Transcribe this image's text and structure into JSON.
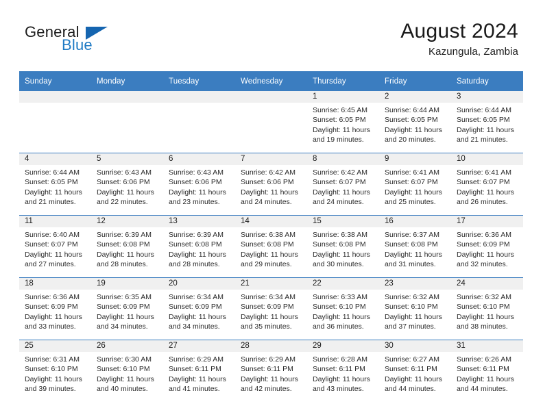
{
  "brand": {
    "word_one": "General",
    "word_two": "Blue",
    "triangle_icon": "triangle-icon",
    "accent_color": "#1f7ac4",
    "triangle_color": "#1565b0"
  },
  "header": {
    "title": "August 2024",
    "subtitle": "Kazungula, Zambia"
  },
  "theme": {
    "header_bg": "#3b7dc0",
    "header_text": "#ffffff",
    "daynum_bg": "#f0f0f0",
    "cell_bg": "#ffffff",
    "row_divider": "#3b7dc0"
  },
  "weekdays": [
    "Sunday",
    "Monday",
    "Tuesday",
    "Wednesday",
    "Thursday",
    "Friday",
    "Saturday"
  ],
  "labels": {
    "sunrise_prefix": "Sunrise:",
    "sunset_prefix": "Sunset:",
    "daylight_prefix": "Daylight:"
  },
  "weeks": [
    [
      {
        "day": "",
        "empty": true
      },
      {
        "day": "",
        "empty": true
      },
      {
        "day": "",
        "empty": true
      },
      {
        "day": "",
        "empty": true
      },
      {
        "day": "1",
        "sunrise": "Sunrise: 6:45 AM",
        "sunset": "Sunset: 6:05 PM",
        "daylight_line1": "Daylight: 11 hours",
        "daylight_line2": "and 19 minutes."
      },
      {
        "day": "2",
        "sunrise": "Sunrise: 6:44 AM",
        "sunset": "Sunset: 6:05 PM",
        "daylight_line1": "Daylight: 11 hours",
        "daylight_line2": "and 20 minutes."
      },
      {
        "day": "3",
        "sunrise": "Sunrise: 6:44 AM",
        "sunset": "Sunset: 6:05 PM",
        "daylight_line1": "Daylight: 11 hours",
        "daylight_line2": "and 21 minutes."
      }
    ],
    [
      {
        "day": "4",
        "sunrise": "Sunrise: 6:44 AM",
        "sunset": "Sunset: 6:05 PM",
        "daylight_line1": "Daylight: 11 hours",
        "daylight_line2": "and 21 minutes."
      },
      {
        "day": "5",
        "sunrise": "Sunrise: 6:43 AM",
        "sunset": "Sunset: 6:06 PM",
        "daylight_line1": "Daylight: 11 hours",
        "daylight_line2": "and 22 minutes."
      },
      {
        "day": "6",
        "sunrise": "Sunrise: 6:43 AM",
        "sunset": "Sunset: 6:06 PM",
        "daylight_line1": "Daylight: 11 hours",
        "daylight_line2": "and 23 minutes."
      },
      {
        "day": "7",
        "sunrise": "Sunrise: 6:42 AM",
        "sunset": "Sunset: 6:06 PM",
        "daylight_line1": "Daylight: 11 hours",
        "daylight_line2": "and 24 minutes."
      },
      {
        "day": "8",
        "sunrise": "Sunrise: 6:42 AM",
        "sunset": "Sunset: 6:07 PM",
        "daylight_line1": "Daylight: 11 hours",
        "daylight_line2": "and 24 minutes."
      },
      {
        "day": "9",
        "sunrise": "Sunrise: 6:41 AM",
        "sunset": "Sunset: 6:07 PM",
        "daylight_line1": "Daylight: 11 hours",
        "daylight_line2": "and 25 minutes."
      },
      {
        "day": "10",
        "sunrise": "Sunrise: 6:41 AM",
        "sunset": "Sunset: 6:07 PM",
        "daylight_line1": "Daylight: 11 hours",
        "daylight_line2": "and 26 minutes."
      }
    ],
    [
      {
        "day": "11",
        "sunrise": "Sunrise: 6:40 AM",
        "sunset": "Sunset: 6:07 PM",
        "daylight_line1": "Daylight: 11 hours",
        "daylight_line2": "and 27 minutes."
      },
      {
        "day": "12",
        "sunrise": "Sunrise: 6:39 AM",
        "sunset": "Sunset: 6:08 PM",
        "daylight_line1": "Daylight: 11 hours",
        "daylight_line2": "and 28 minutes."
      },
      {
        "day": "13",
        "sunrise": "Sunrise: 6:39 AM",
        "sunset": "Sunset: 6:08 PM",
        "daylight_line1": "Daylight: 11 hours",
        "daylight_line2": "and 28 minutes."
      },
      {
        "day": "14",
        "sunrise": "Sunrise: 6:38 AM",
        "sunset": "Sunset: 6:08 PM",
        "daylight_line1": "Daylight: 11 hours",
        "daylight_line2": "and 29 minutes."
      },
      {
        "day": "15",
        "sunrise": "Sunrise: 6:38 AM",
        "sunset": "Sunset: 6:08 PM",
        "daylight_line1": "Daylight: 11 hours",
        "daylight_line2": "and 30 minutes."
      },
      {
        "day": "16",
        "sunrise": "Sunrise: 6:37 AM",
        "sunset": "Sunset: 6:08 PM",
        "daylight_line1": "Daylight: 11 hours",
        "daylight_line2": "and 31 minutes."
      },
      {
        "day": "17",
        "sunrise": "Sunrise: 6:36 AM",
        "sunset": "Sunset: 6:09 PM",
        "daylight_line1": "Daylight: 11 hours",
        "daylight_line2": "and 32 minutes."
      }
    ],
    [
      {
        "day": "18",
        "sunrise": "Sunrise: 6:36 AM",
        "sunset": "Sunset: 6:09 PM",
        "daylight_line1": "Daylight: 11 hours",
        "daylight_line2": "and 33 minutes."
      },
      {
        "day": "19",
        "sunrise": "Sunrise: 6:35 AM",
        "sunset": "Sunset: 6:09 PM",
        "daylight_line1": "Daylight: 11 hours",
        "daylight_line2": "and 34 minutes."
      },
      {
        "day": "20",
        "sunrise": "Sunrise: 6:34 AM",
        "sunset": "Sunset: 6:09 PM",
        "daylight_line1": "Daylight: 11 hours",
        "daylight_line2": "and 34 minutes."
      },
      {
        "day": "21",
        "sunrise": "Sunrise: 6:34 AM",
        "sunset": "Sunset: 6:09 PM",
        "daylight_line1": "Daylight: 11 hours",
        "daylight_line2": "and 35 minutes."
      },
      {
        "day": "22",
        "sunrise": "Sunrise: 6:33 AM",
        "sunset": "Sunset: 6:10 PM",
        "daylight_line1": "Daylight: 11 hours",
        "daylight_line2": "and 36 minutes."
      },
      {
        "day": "23",
        "sunrise": "Sunrise: 6:32 AM",
        "sunset": "Sunset: 6:10 PM",
        "daylight_line1": "Daylight: 11 hours",
        "daylight_line2": "and 37 minutes."
      },
      {
        "day": "24",
        "sunrise": "Sunrise: 6:32 AM",
        "sunset": "Sunset: 6:10 PM",
        "daylight_line1": "Daylight: 11 hours",
        "daylight_line2": "and 38 minutes."
      }
    ],
    [
      {
        "day": "25",
        "sunrise": "Sunrise: 6:31 AM",
        "sunset": "Sunset: 6:10 PM",
        "daylight_line1": "Daylight: 11 hours",
        "daylight_line2": "and 39 minutes."
      },
      {
        "day": "26",
        "sunrise": "Sunrise: 6:30 AM",
        "sunset": "Sunset: 6:10 PM",
        "daylight_line1": "Daylight: 11 hours",
        "daylight_line2": "and 40 minutes."
      },
      {
        "day": "27",
        "sunrise": "Sunrise: 6:29 AM",
        "sunset": "Sunset: 6:11 PM",
        "daylight_line1": "Daylight: 11 hours",
        "daylight_line2": "and 41 minutes."
      },
      {
        "day": "28",
        "sunrise": "Sunrise: 6:29 AM",
        "sunset": "Sunset: 6:11 PM",
        "daylight_line1": "Daylight: 11 hours",
        "daylight_line2": "and 42 minutes."
      },
      {
        "day": "29",
        "sunrise": "Sunrise: 6:28 AM",
        "sunset": "Sunset: 6:11 PM",
        "daylight_line1": "Daylight: 11 hours",
        "daylight_line2": "and 43 minutes."
      },
      {
        "day": "30",
        "sunrise": "Sunrise: 6:27 AM",
        "sunset": "Sunset: 6:11 PM",
        "daylight_line1": "Daylight: 11 hours",
        "daylight_line2": "and 44 minutes."
      },
      {
        "day": "31",
        "sunrise": "Sunrise: 6:26 AM",
        "sunset": "Sunset: 6:11 PM",
        "daylight_line1": "Daylight: 11 hours",
        "daylight_line2": "and 44 minutes."
      }
    ]
  ]
}
